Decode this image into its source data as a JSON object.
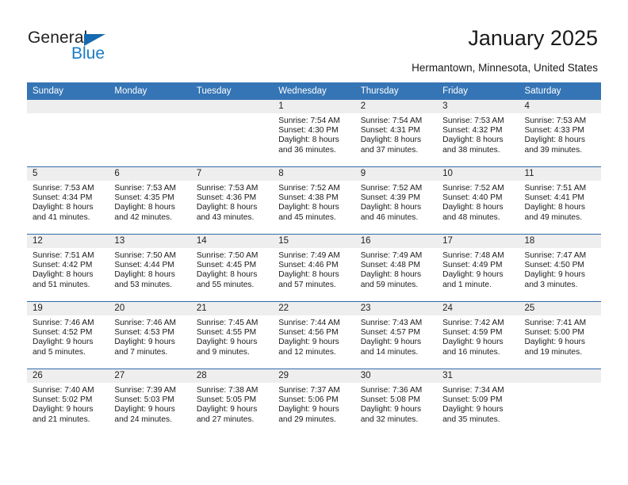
{
  "brand": {
    "name_top": "General",
    "name_bottom": "Blue",
    "accent_color": "#1a7cc4",
    "triangle_color": "#1769b0"
  },
  "header": {
    "title": "January 2025",
    "location": "Hermantown, Minnesota, United States"
  },
  "calendar": {
    "header_bg": "#3575b5",
    "header_text_color": "#ffffff",
    "daynum_band_color": "#eeeeee",
    "row_separator_color": "#2f6ca8",
    "weekday_headers": [
      "Sunday",
      "Monday",
      "Tuesday",
      "Wednesday",
      "Thursday",
      "Friday",
      "Saturday"
    ],
    "weeks": [
      [
        {
          "blank": true
        },
        {
          "blank": true
        },
        {
          "blank": true
        },
        {
          "day": "1",
          "sunrise": "Sunrise: 7:54 AM",
          "sunset": "Sunset: 4:30 PM",
          "daylight_1": "Daylight: 8 hours",
          "daylight_2": "and 36 minutes."
        },
        {
          "day": "2",
          "sunrise": "Sunrise: 7:54 AM",
          "sunset": "Sunset: 4:31 PM",
          "daylight_1": "Daylight: 8 hours",
          "daylight_2": "and 37 minutes."
        },
        {
          "day": "3",
          "sunrise": "Sunrise: 7:53 AM",
          "sunset": "Sunset: 4:32 PM",
          "daylight_1": "Daylight: 8 hours",
          "daylight_2": "and 38 minutes."
        },
        {
          "day": "4",
          "sunrise": "Sunrise: 7:53 AM",
          "sunset": "Sunset: 4:33 PM",
          "daylight_1": "Daylight: 8 hours",
          "daylight_2": "and 39 minutes."
        }
      ],
      [
        {
          "day": "5",
          "sunrise": "Sunrise: 7:53 AM",
          "sunset": "Sunset: 4:34 PM",
          "daylight_1": "Daylight: 8 hours",
          "daylight_2": "and 41 minutes."
        },
        {
          "day": "6",
          "sunrise": "Sunrise: 7:53 AM",
          "sunset": "Sunset: 4:35 PM",
          "daylight_1": "Daylight: 8 hours",
          "daylight_2": "and 42 minutes."
        },
        {
          "day": "7",
          "sunrise": "Sunrise: 7:53 AM",
          "sunset": "Sunset: 4:36 PM",
          "daylight_1": "Daylight: 8 hours",
          "daylight_2": "and 43 minutes."
        },
        {
          "day": "8",
          "sunrise": "Sunrise: 7:52 AM",
          "sunset": "Sunset: 4:38 PM",
          "daylight_1": "Daylight: 8 hours",
          "daylight_2": "and 45 minutes."
        },
        {
          "day": "9",
          "sunrise": "Sunrise: 7:52 AM",
          "sunset": "Sunset: 4:39 PM",
          "daylight_1": "Daylight: 8 hours",
          "daylight_2": "and 46 minutes."
        },
        {
          "day": "10",
          "sunrise": "Sunrise: 7:52 AM",
          "sunset": "Sunset: 4:40 PM",
          "daylight_1": "Daylight: 8 hours",
          "daylight_2": "and 48 minutes."
        },
        {
          "day": "11",
          "sunrise": "Sunrise: 7:51 AM",
          "sunset": "Sunset: 4:41 PM",
          "daylight_1": "Daylight: 8 hours",
          "daylight_2": "and 49 minutes."
        }
      ],
      [
        {
          "day": "12",
          "sunrise": "Sunrise: 7:51 AM",
          "sunset": "Sunset: 4:42 PM",
          "daylight_1": "Daylight: 8 hours",
          "daylight_2": "and 51 minutes."
        },
        {
          "day": "13",
          "sunrise": "Sunrise: 7:50 AM",
          "sunset": "Sunset: 4:44 PM",
          "daylight_1": "Daylight: 8 hours",
          "daylight_2": "and 53 minutes."
        },
        {
          "day": "14",
          "sunrise": "Sunrise: 7:50 AM",
          "sunset": "Sunset: 4:45 PM",
          "daylight_1": "Daylight: 8 hours",
          "daylight_2": "and 55 minutes."
        },
        {
          "day": "15",
          "sunrise": "Sunrise: 7:49 AM",
          "sunset": "Sunset: 4:46 PM",
          "daylight_1": "Daylight: 8 hours",
          "daylight_2": "and 57 minutes."
        },
        {
          "day": "16",
          "sunrise": "Sunrise: 7:49 AM",
          "sunset": "Sunset: 4:48 PM",
          "daylight_1": "Daylight: 8 hours",
          "daylight_2": "and 59 minutes."
        },
        {
          "day": "17",
          "sunrise": "Sunrise: 7:48 AM",
          "sunset": "Sunset: 4:49 PM",
          "daylight_1": "Daylight: 9 hours",
          "daylight_2": "and 1 minute."
        },
        {
          "day": "18",
          "sunrise": "Sunrise: 7:47 AM",
          "sunset": "Sunset: 4:50 PM",
          "daylight_1": "Daylight: 9 hours",
          "daylight_2": "and 3 minutes."
        }
      ],
      [
        {
          "day": "19",
          "sunrise": "Sunrise: 7:46 AM",
          "sunset": "Sunset: 4:52 PM",
          "daylight_1": "Daylight: 9 hours",
          "daylight_2": "and 5 minutes."
        },
        {
          "day": "20",
          "sunrise": "Sunrise: 7:46 AM",
          "sunset": "Sunset: 4:53 PM",
          "daylight_1": "Daylight: 9 hours",
          "daylight_2": "and 7 minutes."
        },
        {
          "day": "21",
          "sunrise": "Sunrise: 7:45 AM",
          "sunset": "Sunset: 4:55 PM",
          "daylight_1": "Daylight: 9 hours",
          "daylight_2": "and 9 minutes."
        },
        {
          "day": "22",
          "sunrise": "Sunrise: 7:44 AM",
          "sunset": "Sunset: 4:56 PM",
          "daylight_1": "Daylight: 9 hours",
          "daylight_2": "and 12 minutes."
        },
        {
          "day": "23",
          "sunrise": "Sunrise: 7:43 AM",
          "sunset": "Sunset: 4:57 PM",
          "daylight_1": "Daylight: 9 hours",
          "daylight_2": "and 14 minutes."
        },
        {
          "day": "24",
          "sunrise": "Sunrise: 7:42 AM",
          "sunset": "Sunset: 4:59 PM",
          "daylight_1": "Daylight: 9 hours",
          "daylight_2": "and 16 minutes."
        },
        {
          "day": "25",
          "sunrise": "Sunrise: 7:41 AM",
          "sunset": "Sunset: 5:00 PM",
          "daylight_1": "Daylight: 9 hours",
          "daylight_2": "and 19 minutes."
        }
      ],
      [
        {
          "day": "26",
          "sunrise": "Sunrise: 7:40 AM",
          "sunset": "Sunset: 5:02 PM",
          "daylight_1": "Daylight: 9 hours",
          "daylight_2": "and 21 minutes."
        },
        {
          "day": "27",
          "sunrise": "Sunrise: 7:39 AM",
          "sunset": "Sunset: 5:03 PM",
          "daylight_1": "Daylight: 9 hours",
          "daylight_2": "and 24 minutes."
        },
        {
          "day": "28",
          "sunrise": "Sunrise: 7:38 AM",
          "sunset": "Sunset: 5:05 PM",
          "daylight_1": "Daylight: 9 hours",
          "daylight_2": "and 27 minutes."
        },
        {
          "day": "29",
          "sunrise": "Sunrise: 7:37 AM",
          "sunset": "Sunset: 5:06 PM",
          "daylight_1": "Daylight: 9 hours",
          "daylight_2": "and 29 minutes."
        },
        {
          "day": "30",
          "sunrise": "Sunrise: 7:36 AM",
          "sunset": "Sunset: 5:08 PM",
          "daylight_1": "Daylight: 9 hours",
          "daylight_2": "and 32 minutes."
        },
        {
          "day": "31",
          "sunrise": "Sunrise: 7:34 AM",
          "sunset": "Sunset: 5:09 PM",
          "daylight_1": "Daylight: 9 hours",
          "daylight_2": "and 35 minutes."
        },
        {
          "blank": true
        }
      ]
    ]
  }
}
